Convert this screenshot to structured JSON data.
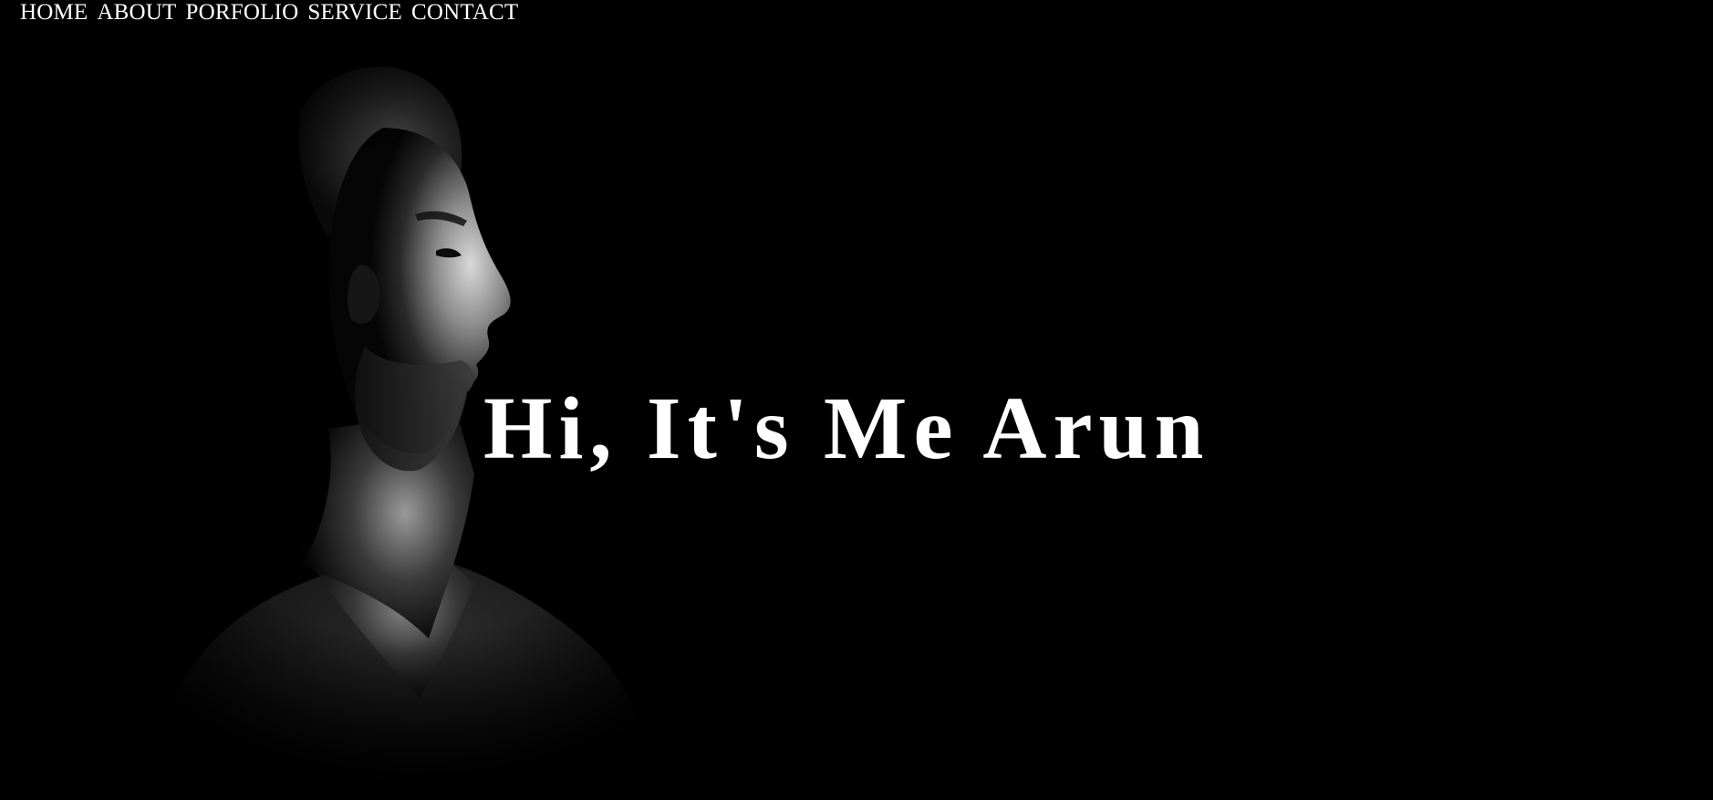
{
  "nav": {
    "items": [
      {
        "label": "HOME"
      },
      {
        "label": "ABOUT"
      },
      {
        "label": "PORFOLIO"
      },
      {
        "label": "SERVICE"
      },
      {
        "label": "CONTACT"
      }
    ]
  },
  "hero": {
    "headline": "Hi, It's Me Arun",
    "background_color": "#000000",
    "text_color": "#ffffff"
  }
}
